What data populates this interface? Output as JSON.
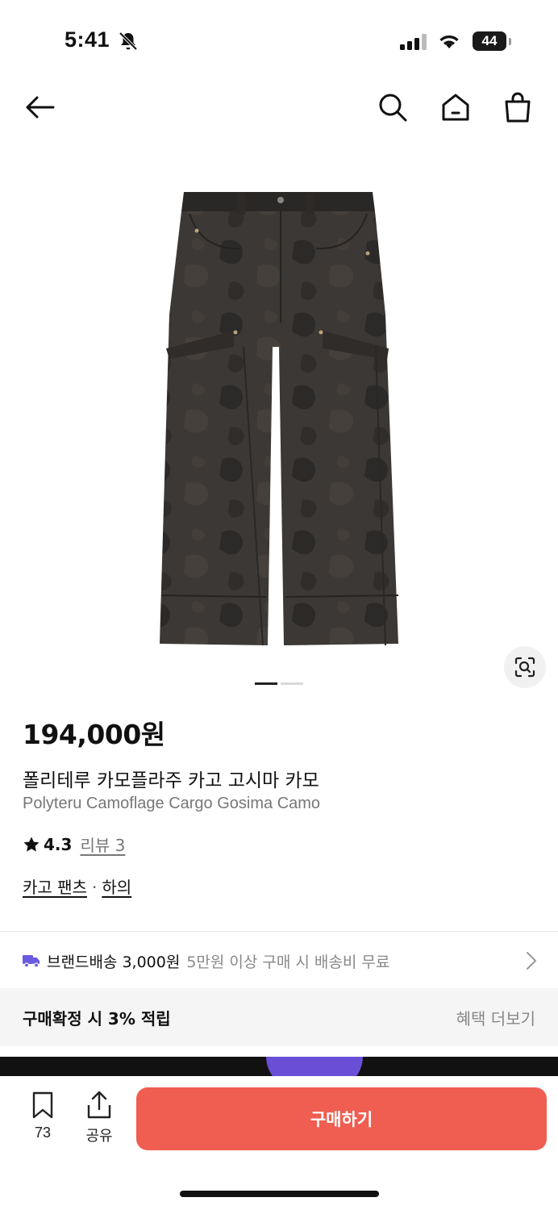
{
  "status_bar": {
    "time": "5:41",
    "battery": "44"
  },
  "product": {
    "price": "194,000원",
    "name_ko": "폴리테루 카모플라주 카고 고시마 카모",
    "name_en": "Polyteru Camoflage Cargo Gosima Camo",
    "rating": "4.3",
    "review_label": "리뷰 3",
    "category": "카고 팬츠",
    "category_separator": "·",
    "subcategory": "하의",
    "image_count": 2,
    "active_image": 1
  },
  "shipping": {
    "label": "브랜드배송 3,000원",
    "condition": "5만원 이상 구매 시 배송비 무료"
  },
  "points": {
    "text": "구매확정 시 3% 적립",
    "more_label": "혜택 더보기"
  },
  "bottom_bar": {
    "save_count": "73",
    "share_label": "공유",
    "buy_label": "구매하기"
  },
  "colors": {
    "accent": "#ef5e51",
    "truck": "#6a5ae0",
    "muted_text": "#777777"
  }
}
